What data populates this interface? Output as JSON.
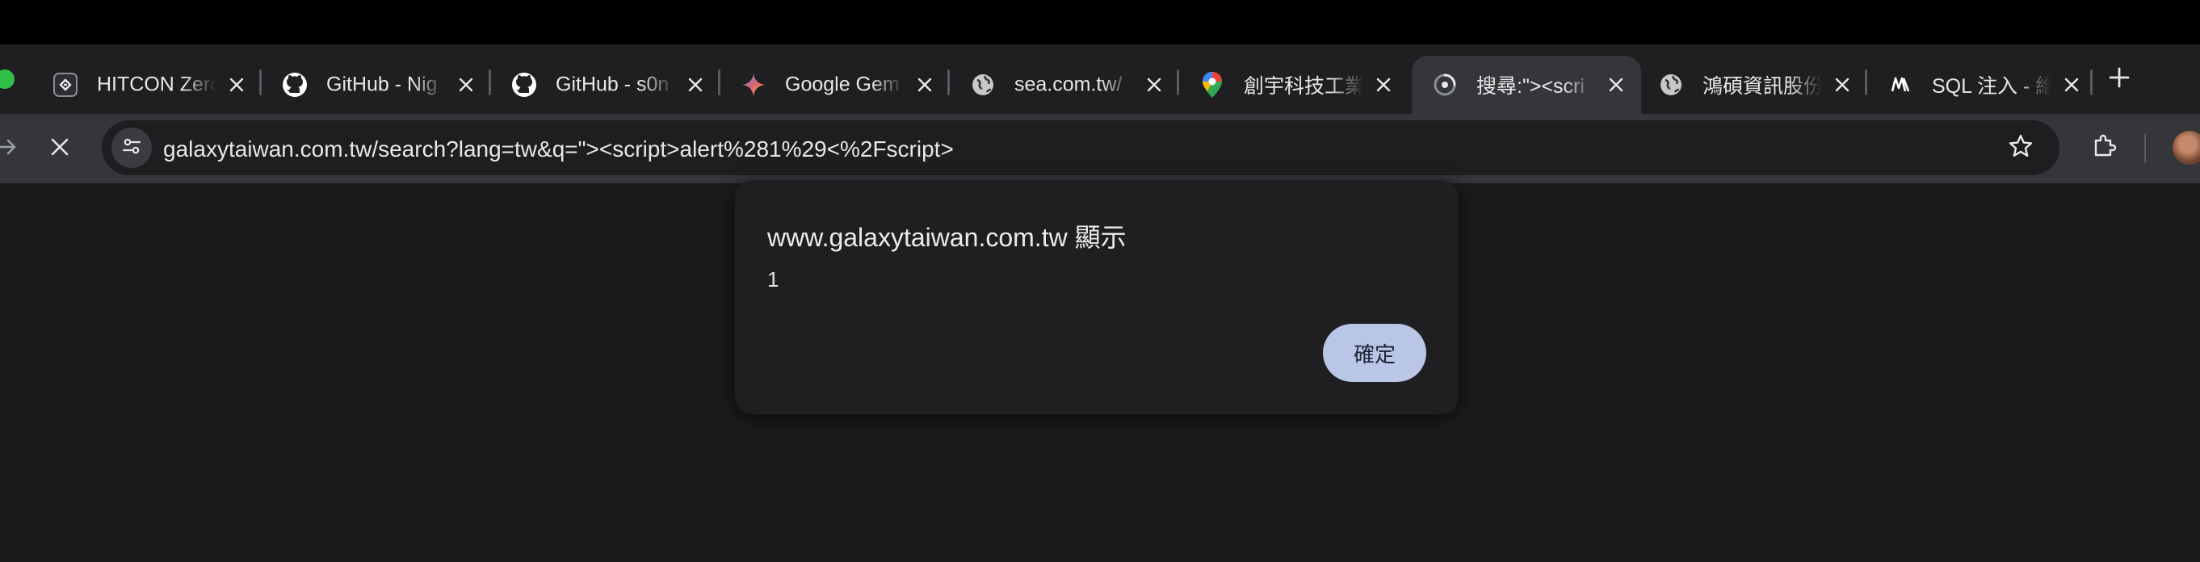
{
  "tabs": [
    {
      "title": "HITCON Zero",
      "icon": "hitcon-zeroday-icon",
      "active": false
    },
    {
      "title": "GitHub - Nig",
      "icon": "github-icon",
      "active": false
    },
    {
      "title": "GitHub - s0n",
      "icon": "github-icon",
      "active": false
    },
    {
      "title": "Google Gem",
      "icon": "gemini-sparkle-icon",
      "active": false
    },
    {
      "title": "sea.com.tw/",
      "icon": "globe-icon",
      "active": false
    },
    {
      "title": "創宇科技工業",
      "icon": "maps-pin-icon",
      "active": false
    },
    {
      "title": "搜尋:\"><scri",
      "icon": "loading-spinner-icon",
      "active": true
    },
    {
      "title": "鴻碩資訊股份",
      "icon": "globe-icon",
      "active": false
    },
    {
      "title": "SQL 注入 - 維",
      "icon": "medium-logo-icon",
      "active": false
    }
  ],
  "omnibox": {
    "url": "galaxytaiwan.com.tw/search?lang=tw&q=\"><script>alert%281%29<%2Fscript>"
  },
  "dialog": {
    "title": "www.galaxytaiwan.com.tw 顯示",
    "message": "1",
    "ok_label": "確定"
  },
  "colors": {
    "tab_strip_bg": "#1f1f21",
    "toolbar_bg": "#35363a",
    "omnibox_bg": "#1d1e20",
    "content_bg": "#1b1b1d",
    "dialog_bg": "#1f1f21",
    "ok_button_bg": "#bac6e6",
    "accent_green": "#30c048"
  }
}
